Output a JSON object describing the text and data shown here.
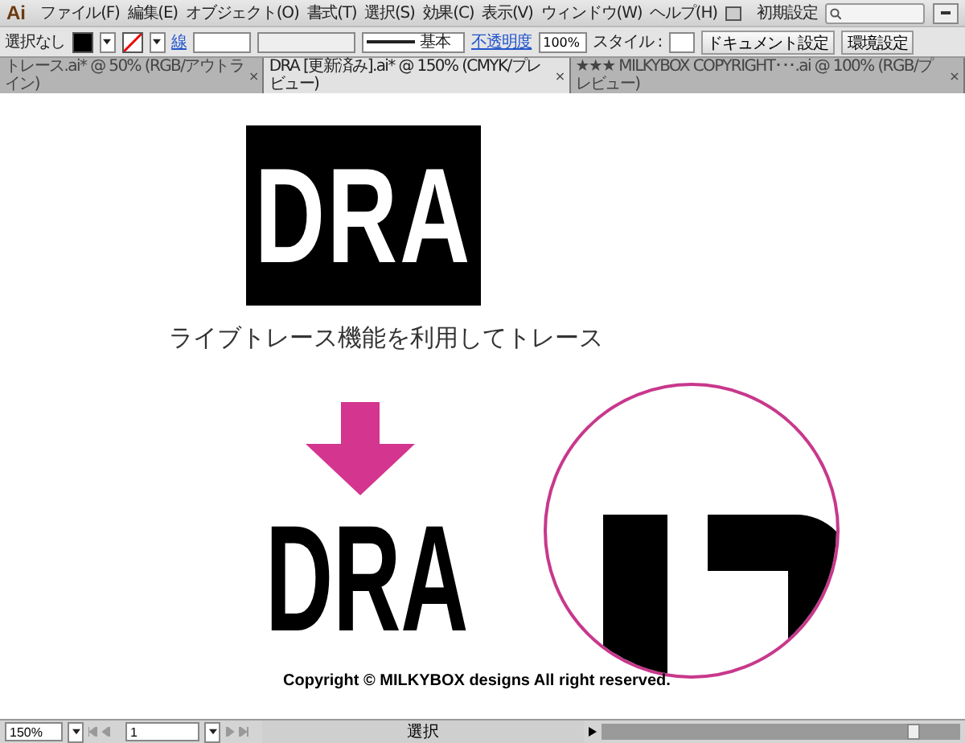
{
  "app": {
    "logo": "Ai",
    "workspace": "初期設定"
  },
  "menu": [
    "ファイル(F)",
    "編集(E)",
    "オブジェクト(O)",
    "書式(T)",
    "選択(S)",
    "効果(C)",
    "表示(V)",
    "ウィンドウ(W)",
    "ヘルプ(H)"
  ],
  "control_bar": {
    "selection": "選択なし",
    "stroke_label": "線",
    "stroke_profile": "基本",
    "opacity_label": "不透明度",
    "opacity": "100%",
    "style_label": "スタイル :",
    "buttons": [
      "ドキュメント設定",
      "環境設定"
    ]
  },
  "tabs": [
    {
      "label": "トレース.ai* @ 50% (RGB/アウトライン)",
      "close": "×",
      "selected": false
    },
    {
      "label": "DRA [更新済み].ai* @ 150% (CMYK/プレビュー)",
      "close": "×",
      "selected": true
    },
    {
      "label": "★★★ MILKYBOX  COPYRIGHT･･･.ai @ 100% (RGB/プレビュー)",
      "close": "×",
      "selected": false
    }
  ],
  "canvas": {
    "logo_text": "DRA",
    "caption": "ライブトレース機能を利用してトレース",
    "traced_text": "DRA",
    "copyright": "Copyright © MILKYBOX designs All right reserved."
  },
  "status_bar": {
    "zoom": "150%",
    "page": "1",
    "tool": "選択"
  }
}
